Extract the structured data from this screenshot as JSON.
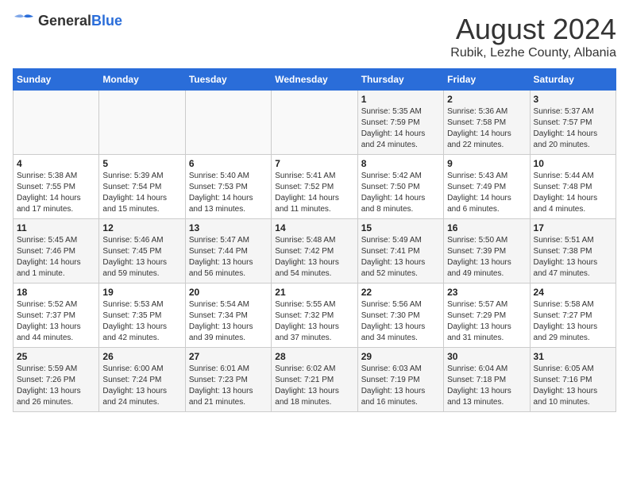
{
  "header": {
    "logo_general": "General",
    "logo_blue": "Blue",
    "month_year": "August 2024",
    "location": "Rubik, Lezhe County, Albania"
  },
  "weekdays": [
    "Sunday",
    "Monday",
    "Tuesday",
    "Wednesday",
    "Thursday",
    "Friday",
    "Saturday"
  ],
  "weeks": [
    [
      {
        "day": "",
        "info": ""
      },
      {
        "day": "",
        "info": ""
      },
      {
        "day": "",
        "info": ""
      },
      {
        "day": "",
        "info": ""
      },
      {
        "day": "1",
        "info": "Sunrise: 5:35 AM\nSunset: 7:59 PM\nDaylight: 14 hours\nand 24 minutes."
      },
      {
        "day": "2",
        "info": "Sunrise: 5:36 AM\nSunset: 7:58 PM\nDaylight: 14 hours\nand 22 minutes."
      },
      {
        "day": "3",
        "info": "Sunrise: 5:37 AM\nSunset: 7:57 PM\nDaylight: 14 hours\nand 20 minutes."
      }
    ],
    [
      {
        "day": "4",
        "info": "Sunrise: 5:38 AM\nSunset: 7:55 PM\nDaylight: 14 hours\nand 17 minutes."
      },
      {
        "day": "5",
        "info": "Sunrise: 5:39 AM\nSunset: 7:54 PM\nDaylight: 14 hours\nand 15 minutes."
      },
      {
        "day": "6",
        "info": "Sunrise: 5:40 AM\nSunset: 7:53 PM\nDaylight: 14 hours\nand 13 minutes."
      },
      {
        "day": "7",
        "info": "Sunrise: 5:41 AM\nSunset: 7:52 PM\nDaylight: 14 hours\nand 11 minutes."
      },
      {
        "day": "8",
        "info": "Sunrise: 5:42 AM\nSunset: 7:50 PM\nDaylight: 14 hours\nand 8 minutes."
      },
      {
        "day": "9",
        "info": "Sunrise: 5:43 AM\nSunset: 7:49 PM\nDaylight: 14 hours\nand 6 minutes."
      },
      {
        "day": "10",
        "info": "Sunrise: 5:44 AM\nSunset: 7:48 PM\nDaylight: 14 hours\nand 4 minutes."
      }
    ],
    [
      {
        "day": "11",
        "info": "Sunrise: 5:45 AM\nSunset: 7:46 PM\nDaylight: 14 hours\nand 1 minute."
      },
      {
        "day": "12",
        "info": "Sunrise: 5:46 AM\nSunset: 7:45 PM\nDaylight: 13 hours\nand 59 minutes."
      },
      {
        "day": "13",
        "info": "Sunrise: 5:47 AM\nSunset: 7:44 PM\nDaylight: 13 hours\nand 56 minutes."
      },
      {
        "day": "14",
        "info": "Sunrise: 5:48 AM\nSunset: 7:42 PM\nDaylight: 13 hours\nand 54 minutes."
      },
      {
        "day": "15",
        "info": "Sunrise: 5:49 AM\nSunset: 7:41 PM\nDaylight: 13 hours\nand 52 minutes."
      },
      {
        "day": "16",
        "info": "Sunrise: 5:50 AM\nSunset: 7:39 PM\nDaylight: 13 hours\nand 49 minutes."
      },
      {
        "day": "17",
        "info": "Sunrise: 5:51 AM\nSunset: 7:38 PM\nDaylight: 13 hours\nand 47 minutes."
      }
    ],
    [
      {
        "day": "18",
        "info": "Sunrise: 5:52 AM\nSunset: 7:37 PM\nDaylight: 13 hours\nand 44 minutes."
      },
      {
        "day": "19",
        "info": "Sunrise: 5:53 AM\nSunset: 7:35 PM\nDaylight: 13 hours\nand 42 minutes."
      },
      {
        "day": "20",
        "info": "Sunrise: 5:54 AM\nSunset: 7:34 PM\nDaylight: 13 hours\nand 39 minutes."
      },
      {
        "day": "21",
        "info": "Sunrise: 5:55 AM\nSunset: 7:32 PM\nDaylight: 13 hours\nand 37 minutes."
      },
      {
        "day": "22",
        "info": "Sunrise: 5:56 AM\nSunset: 7:30 PM\nDaylight: 13 hours\nand 34 minutes."
      },
      {
        "day": "23",
        "info": "Sunrise: 5:57 AM\nSunset: 7:29 PM\nDaylight: 13 hours\nand 31 minutes."
      },
      {
        "day": "24",
        "info": "Sunrise: 5:58 AM\nSunset: 7:27 PM\nDaylight: 13 hours\nand 29 minutes."
      }
    ],
    [
      {
        "day": "25",
        "info": "Sunrise: 5:59 AM\nSunset: 7:26 PM\nDaylight: 13 hours\nand 26 minutes."
      },
      {
        "day": "26",
        "info": "Sunrise: 6:00 AM\nSunset: 7:24 PM\nDaylight: 13 hours\nand 24 minutes."
      },
      {
        "day": "27",
        "info": "Sunrise: 6:01 AM\nSunset: 7:23 PM\nDaylight: 13 hours\nand 21 minutes."
      },
      {
        "day": "28",
        "info": "Sunrise: 6:02 AM\nSunset: 7:21 PM\nDaylight: 13 hours\nand 18 minutes."
      },
      {
        "day": "29",
        "info": "Sunrise: 6:03 AM\nSunset: 7:19 PM\nDaylight: 13 hours\nand 16 minutes."
      },
      {
        "day": "30",
        "info": "Sunrise: 6:04 AM\nSunset: 7:18 PM\nDaylight: 13 hours\nand 13 minutes."
      },
      {
        "day": "31",
        "info": "Sunrise: 6:05 AM\nSunset: 7:16 PM\nDaylight: 13 hours\nand 10 minutes."
      }
    ]
  ]
}
